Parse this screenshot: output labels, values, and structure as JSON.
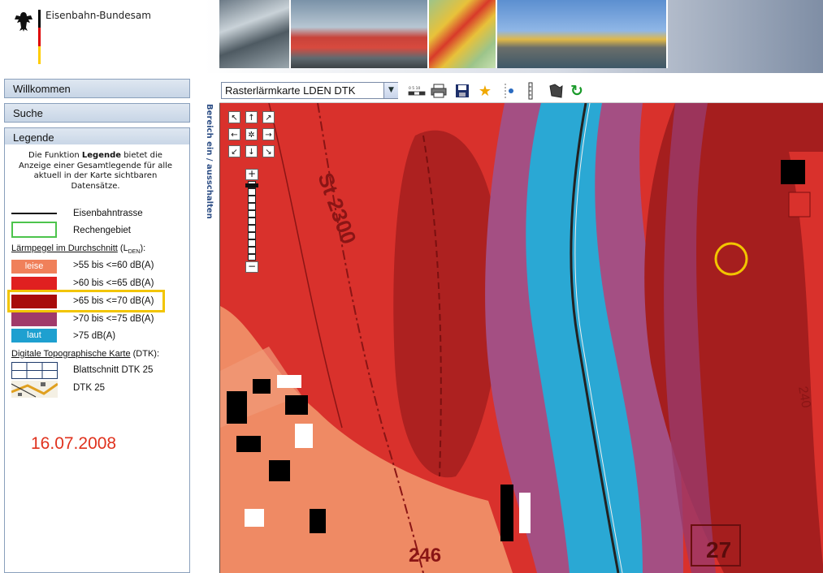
{
  "header": {
    "brand": "Eisenbahn-Bundesamt",
    "brand_colors": [
      "#000000",
      "#dd0000",
      "#ffcc00"
    ]
  },
  "nav": {
    "items": [
      {
        "label": "Willkommen"
      },
      {
        "label": "Suche"
      },
      {
        "label": "Legende"
      }
    ]
  },
  "legend": {
    "description_pre": "Die Funktion ",
    "description_bold": "Legende",
    "description_post": " bietet die Anzeige einer Gesamtlegende für alle aktuell in der Karte sichtbaren Datensätze.",
    "line_items": [
      {
        "label": "Eisenbahntrasse"
      },
      {
        "label": "Rechengebiet"
      }
    ],
    "noise_heading": "Lärmpegel im Durchschnitt",
    "noise_heading_suffix": " (L",
    "noise_heading_sub": "DEN",
    "noise_heading_end": "):",
    "noise_levels": [
      {
        "swatch_text": "leise",
        "label": ">55 bis <=60 dB(A)",
        "color": "#f0805a"
      },
      {
        "swatch_text": "",
        "label": ">60 bis <=65 dB(A)",
        "color": "#e02020"
      },
      {
        "swatch_text": "",
        "label": ">65 bis <=70 dB(A)",
        "color": "#a80c0c"
      },
      {
        "swatch_text": "",
        "label": ">70 bis <=75 dB(A)",
        "color": "#a03a6a"
      },
      {
        "swatch_text": "laut",
        "label": ">75 dB(A)",
        "color": "#1ea0d0"
      }
    ],
    "dtk_heading": "Digitale Topographische Karte",
    "dtk_heading_suffix": " (DTK):",
    "dtk_items": [
      {
        "label": "Blattschnitt DTK 25"
      },
      {
        "label": "DTK 25"
      }
    ]
  },
  "date_stamp": "16.07.2008",
  "toggle_text": "Bereich ein / ausschalten",
  "toolbar": {
    "map_select_value": "Rasterlärmkarte LDEN DTK",
    "tools": [
      "scale-icon",
      "print-icon",
      "save-icon",
      "favorite-star-icon",
      "point-info-icon",
      "measure-icon",
      "pan-hand-icon",
      "refresh-icon"
    ],
    "scale_text": "0 5 10"
  },
  "map": {
    "labels": [
      {
        "text": "St 2300"
      },
      {
        "text": "246"
      },
      {
        "text": "27"
      },
      {
        "text": "240"
      }
    ],
    "colors": {
      "red": "#d9312c",
      "dark_red": "#a51e1e",
      "salmon": "#ef8a64",
      "purple": "#a44f83",
      "blue": "#2aa8d4",
      "highlight": "#f2c500"
    }
  },
  "map_nav": {
    "pad": [
      "↖",
      "↑",
      "↗",
      "←",
      "✲",
      "→",
      "↙",
      "↓",
      "↘"
    ],
    "zoom_in": "+",
    "zoom_out": "−"
  }
}
